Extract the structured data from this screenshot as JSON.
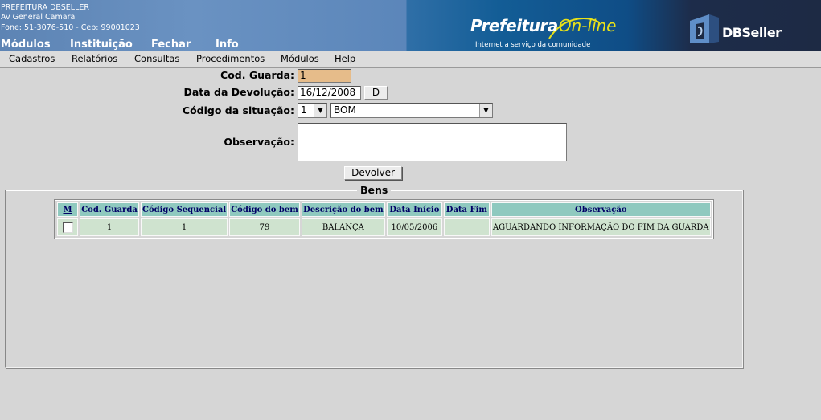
{
  "header": {
    "org_name": "PREFEITURA DBSELLER",
    "org_address": "Av General Camara",
    "org_phone": "Fone: 51-3076-510  -  Cep: 99001023",
    "brand_main": "Prefeitura",
    "brand_online": "On-line",
    "brand_tagline": "Internet a serviço da comunidade",
    "vendor": "DBSeller",
    "menu": [
      "Módulos",
      "Instituição",
      "Fechar",
      "Info"
    ]
  },
  "menubar": [
    "Cadastros",
    "Relatórios",
    "Consultas",
    "Procedimentos",
    "Módulos",
    "Help"
  ],
  "form": {
    "cod_guarda_label": "Cod. Guarda:",
    "cod_guarda_value": "1",
    "data_label": "Data da Devolução:",
    "data_value": "16/12/2008",
    "data_button": "D",
    "situacao_label": "Código da situação:",
    "situacao_code": "1",
    "situacao_desc": "BOM",
    "obs_label": "Observação:",
    "obs_value": "",
    "submit_label": "Devolver"
  },
  "bens": {
    "legend": "Bens",
    "columns": [
      "M",
      "Cod. Guarda",
      "Código Sequencial",
      "Código do bem",
      "Descrição do bem",
      "Data Início",
      "Data Fim",
      "Observação"
    ],
    "rows": [
      {
        "checked": false,
        "cod_guarda": "1",
        "codigo_sequencial": "1",
        "codigo_bem": "79",
        "descricao": "BALANÇA",
        "data_inicio": "10/05/2006",
        "data_fim": "",
        "observacao": "AGUARDANDO INFORMAÇÃO DO FIM DA GUARDA"
      }
    ]
  },
  "colors": {
    "header_blue": "#5d84b4",
    "brand_yellow": "#e9e218",
    "input_highlight": "#e6bc8a",
    "table_header": "#8fc9bf",
    "table_cell": "#cfe3cf"
  }
}
